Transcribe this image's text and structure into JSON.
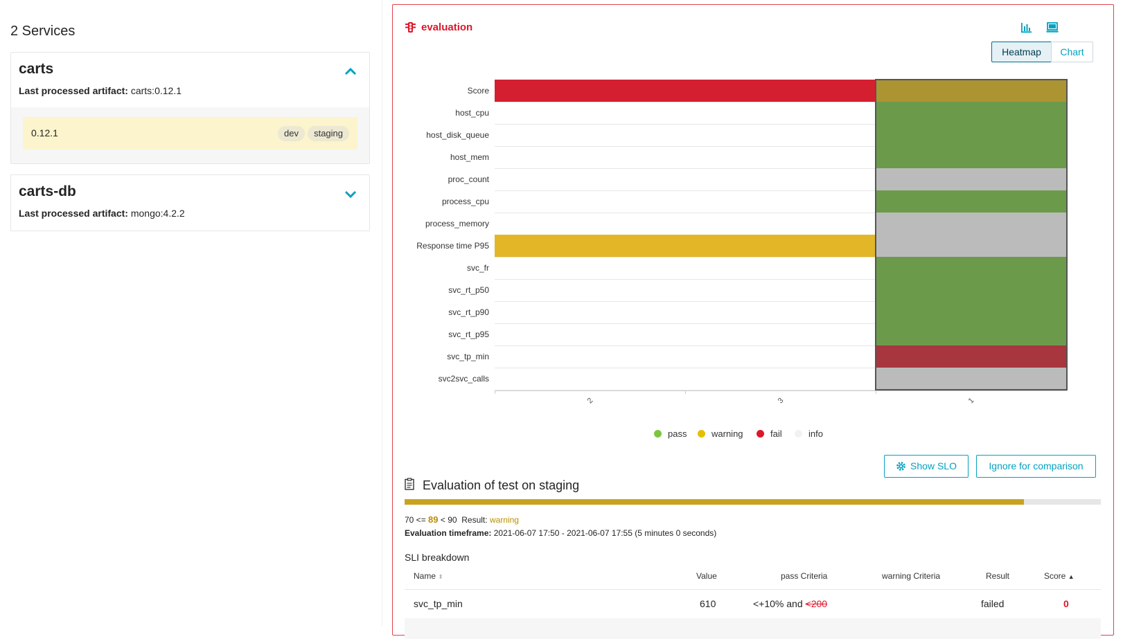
{
  "left": {
    "title": "2 Services",
    "services": [
      {
        "name": "carts",
        "artifact_label": "Last processed artifact:",
        "artifact_value": "carts:0.12.1",
        "expanded": true,
        "version": "0.12.1",
        "stages": [
          "dev",
          "staging"
        ]
      },
      {
        "name": "carts-db",
        "artifact_label": "Last processed artifact:",
        "artifact_value": "mongo:4.2.2",
        "expanded": false
      }
    ]
  },
  "evaluation": {
    "title": "evaluation",
    "icons": [
      "traffic-light-icon",
      "bar-chart-icon",
      "monitor-icon"
    ],
    "tabs": [
      {
        "label": "Heatmap",
        "active": true
      },
      {
        "label": "Chart",
        "active": false
      }
    ],
    "heatmap": {
      "rows": [
        "Score",
        "host_cpu",
        "host_disk_queue",
        "host_mem",
        "proc_count",
        "process_cpu",
        "process_memory",
        "Response time P95",
        "svc_fr",
        "svc_rt_p50",
        "svc_rt_p90",
        "svc_rt_p95",
        "svc_tp_min",
        "svc2svc_calls"
      ],
      "columns": [
        "2",
        "3",
        "1"
      ],
      "column_fractions": [
        0.333,
        0.333,
        0.334
      ],
      "selected_column": "1",
      "cells": {
        "2": [
          "fail",
          "",
          "",
          "",
          "",
          "",
          "",
          "warning",
          "",
          "",
          "",
          "",
          "",
          ""
        ],
        "3": [
          "fail",
          "",
          "",
          "",
          "",
          "",
          "",
          "warning",
          "",
          "",
          "",
          "",
          "",
          ""
        ],
        "1": [
          "warning",
          "pass",
          "pass",
          "pass",
          "info",
          "pass",
          "info",
          "info",
          "pass",
          "pass",
          "pass",
          "pass",
          "fail",
          "info"
        ]
      },
      "colors": {
        "fail": "#d41f30",
        "warning": "#e2b627",
        "pass": "#6b9b4a",
        "info": "#bbbbbb",
        "fail_selected": "#a8363f",
        "warning_selected": "#ac9433",
        "empty": "#ffffff"
      }
    },
    "legend": [
      {
        "label": "pass",
        "color": "#7dc540"
      },
      {
        "label": "warning",
        "color": "#e6be00"
      },
      {
        "label": "fail",
        "color": "#dc172a"
      },
      {
        "label": "info",
        "color": "#f2f2f2"
      }
    ],
    "buttons": {
      "show_slo": "Show SLO",
      "ignore": "Ignore for comparison"
    },
    "test": {
      "title": "Evaluation of test on staging",
      "score_percent": 89,
      "range_prefix": "70 <=",
      "score": "89",
      "range_suffix": "< 90",
      "result_label": "Result:",
      "result_value": "warning",
      "timeframe_label": "Evaluation timeframe:",
      "timeframe_value": "2021-06-07 17:50 - 2021-06-07 17:55 (5 minutes 0 seconds)"
    },
    "sli": {
      "title": "SLI breakdown",
      "headers": [
        "Name",
        "Value",
        "pass Criteria",
        "warning Criteria",
        "Result",
        "Score"
      ],
      "rows": [
        {
          "name": "svc_tp_min",
          "value": "610",
          "pass_prefix": "<+10% and",
          "pass_struck": "<200",
          "warning": "",
          "result": "failed",
          "score": "0"
        }
      ]
    }
  }
}
